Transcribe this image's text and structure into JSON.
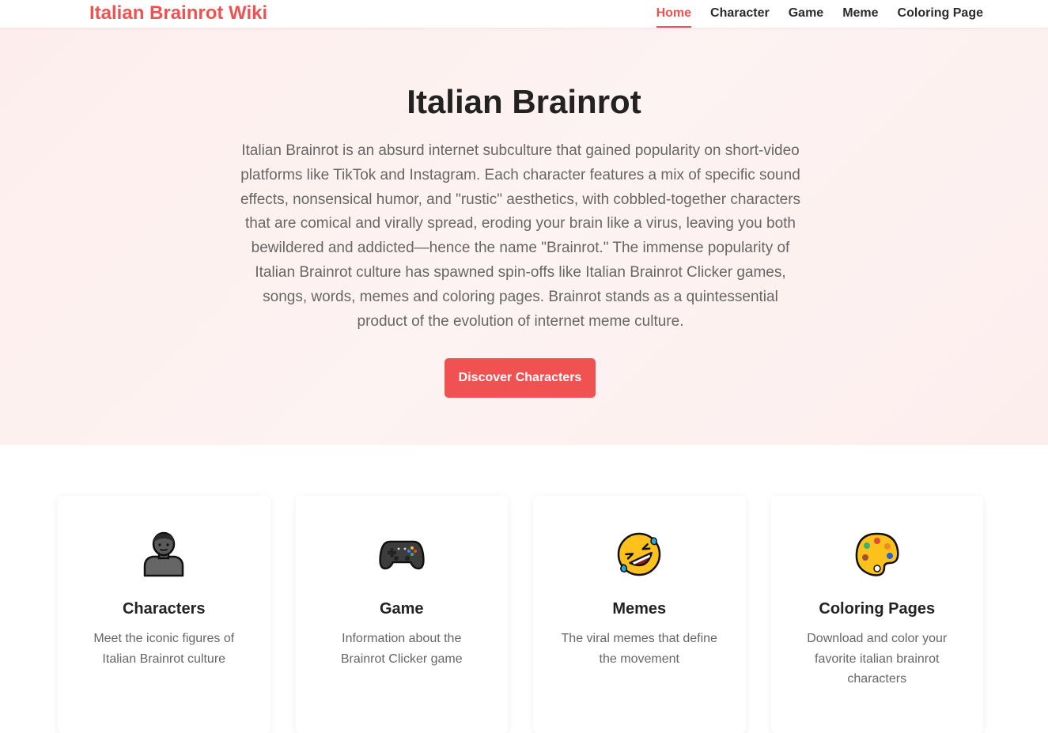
{
  "header": {
    "logo": "Italian Brainrot Wiki",
    "nav": [
      {
        "label": "Home",
        "active": true
      },
      {
        "label": "Character",
        "active": false
      },
      {
        "label": "Game",
        "active": false
      },
      {
        "label": "Meme",
        "active": false
      },
      {
        "label": "Coloring Page",
        "active": false
      }
    ]
  },
  "hero": {
    "title": "Italian Brainrot",
    "description": "Italian Brainrot is an absurd internet subculture that gained popularity on short-video platforms like TikTok and Instagram. Each character features a mix of specific sound effects, nonsensical humor, and \"rustic\" aesthetics, with cobbled-together characters that are comical and virally spread, eroding your brain like a virus, leaving you both bewildered and addicted—hence the name \"Brainrot.\" The immense popularity of Italian Brainrot culture has spawned spin-offs like Italian Brainrot Clicker games, songs, words, memes and coloring pages. Brainrot stands as a quintessential product of the evolution of internet meme culture.",
    "button_label": "Discover Characters"
  },
  "cards": [
    {
      "icon": "person-icon",
      "title": "Characters",
      "description": "Meet the iconic figures of Italian Brainrot culture"
    },
    {
      "icon": "game-controller-icon",
      "title": "Game",
      "description": "Information about the Brainrot Clicker game"
    },
    {
      "icon": "rolling-laughing-emoji-icon",
      "title": "Memes",
      "description": "The viral memes that define the movement"
    },
    {
      "icon": "artist-palette-icon",
      "title": "Coloring Pages",
      "description": "Download and color your favorite italian brainrot characters"
    }
  ],
  "colors": {
    "accent": "#f05252",
    "hero_background": "#fdeeed",
    "text_dark": "#222222",
    "text_muted": "#666666"
  }
}
